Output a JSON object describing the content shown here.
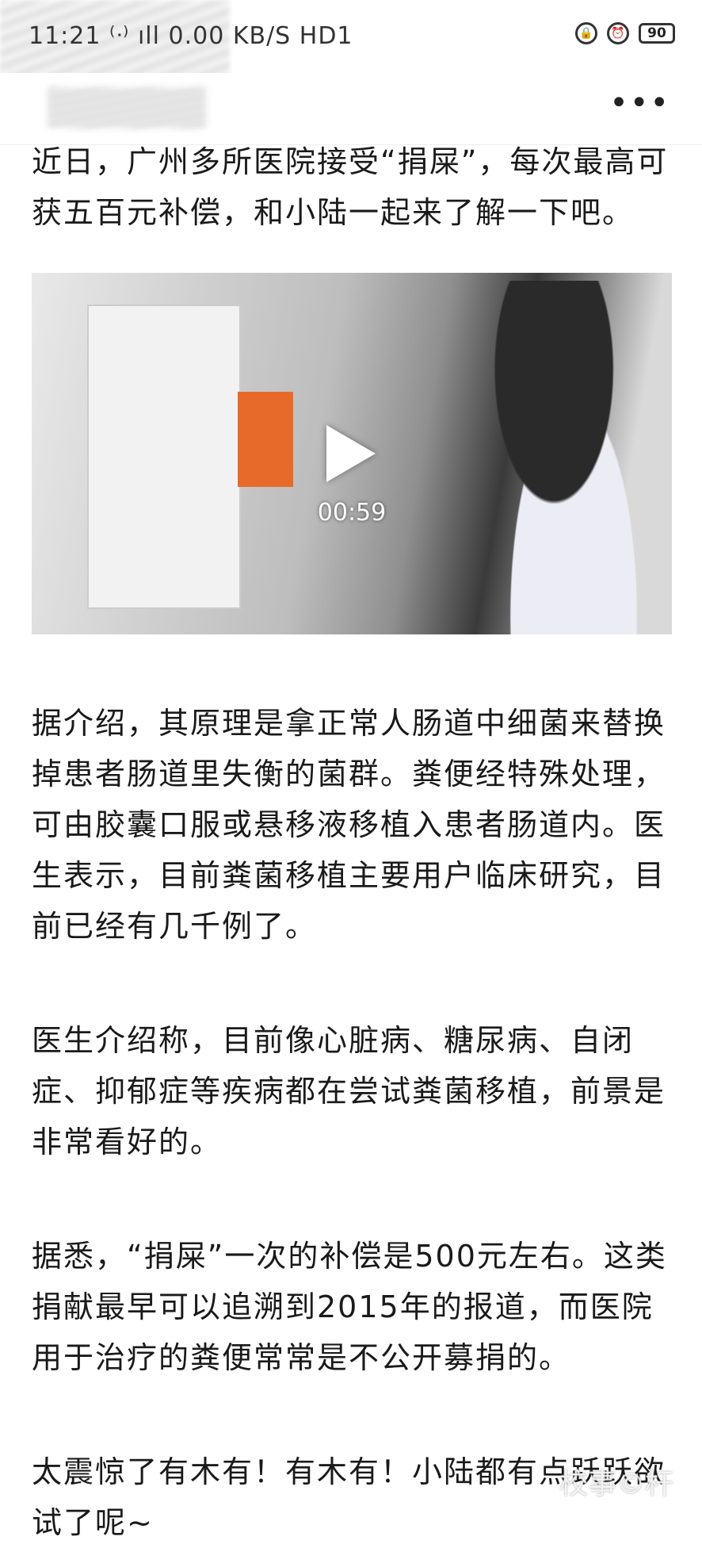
{
  "status_bar": {
    "left_text": "11:21 ⁽ᐧ⁾ ıll 0.00 KB/S HD1",
    "battery": "90",
    "icons": [
      "lock-rotation-icon",
      "alarm-icon",
      "battery-icon"
    ]
  },
  "topbar": {
    "more_label": "•••"
  },
  "article": {
    "intro": "近日，广州多所医院接受“捐屎”，每次最高可获五百元补偿，和小陆一起来了解一下吧。",
    "video": {
      "duration": "00:59"
    },
    "paragraphs": [
      "据介绍，其原理是拿正常人肠道中细菌来替换掉患者肠道里失衡的菌群。粪便经特殊处理，可由胶囊口服或悬移液移植入患者肠道内。医生表示，目前粪菌移植主要用户临床研究，目前已经有几千例了。",
      "医生介绍称，目前像心脏病、糖尿病、自闭症、抑郁症等疾病都在尝试粪菌移植，前景是非常看好的。",
      "据悉，“捐屎”一次的补偿是500元左右。这类捐献最早可以追溯到2015年的报道，而医院用于治疗的粪便常常是不公开募捐的。",
      "太震惊了有木有！有木有！小陆都有点跃跃欲试了呢~"
    ]
  },
  "watermark": "校事©杆"
}
